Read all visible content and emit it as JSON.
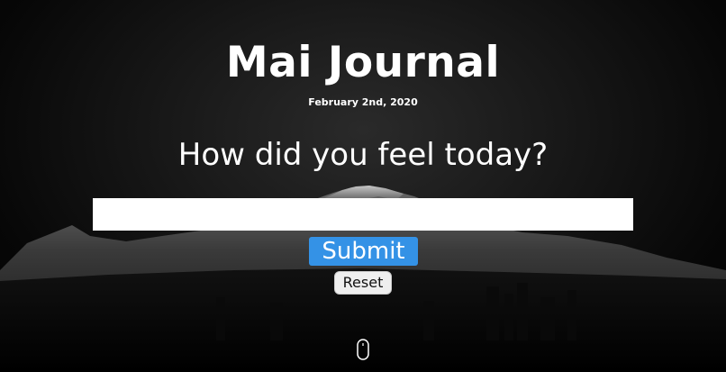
{
  "header": {
    "title": "Mai Journal",
    "date": "February 2nd, 2020"
  },
  "form": {
    "question": "How did you feel today?",
    "entry_value": "",
    "entry_placeholder": "",
    "submit_label": "Submit",
    "reset_label": "Reset"
  },
  "icons": {
    "scroll": "mouse-scroll-icon"
  },
  "colors": {
    "submit_bg": "#3492e6",
    "background": "#000000",
    "text": "#ffffff"
  }
}
